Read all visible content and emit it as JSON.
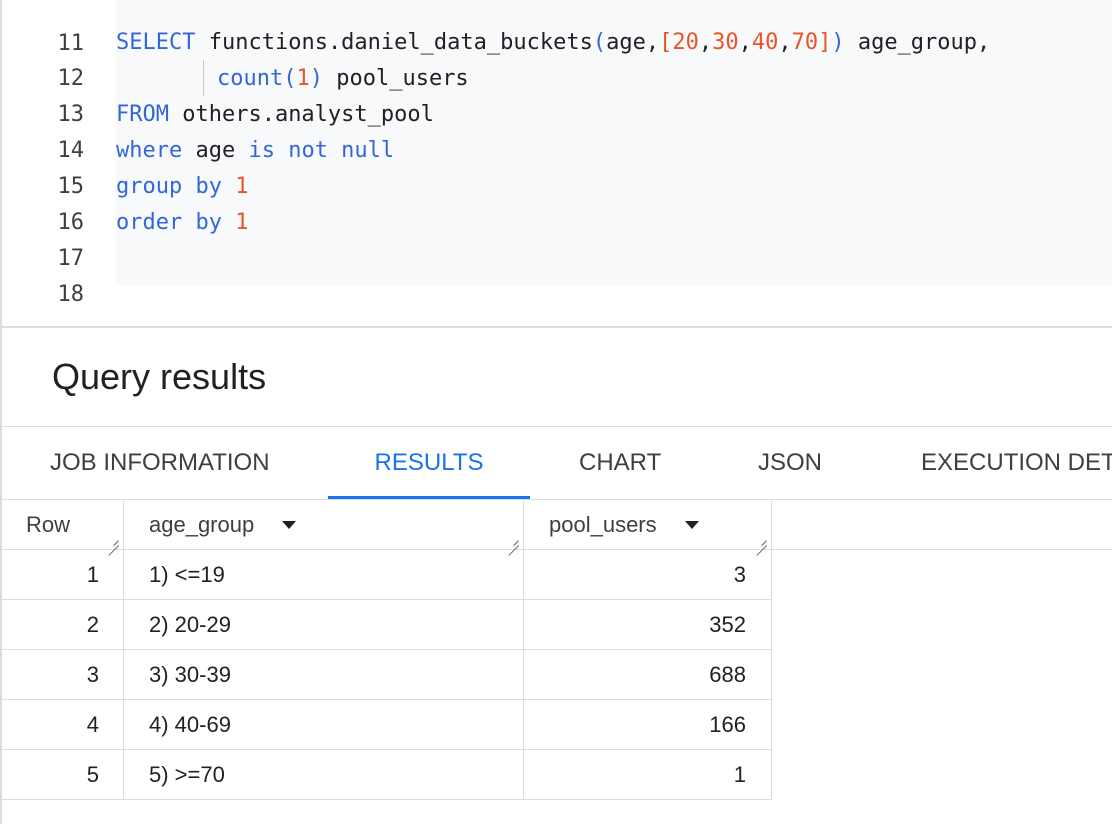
{
  "editor": {
    "lines": [
      {
        "num": "11"
      },
      {
        "num": "12"
      },
      {
        "num": "13"
      },
      {
        "num": "14"
      },
      {
        "num": "15"
      },
      {
        "num": "16"
      },
      {
        "num": "17"
      },
      {
        "num": "18"
      }
    ],
    "tokens": {
      "select": "SELECT",
      "fn_name": "functions.daniel_data_buckets",
      "paren_open": "(",
      "age": "age,",
      "bracket_open": "[",
      "n20": "20",
      "comma1": ",",
      "n30": "30",
      "comma2": ",",
      "n40": "40",
      "comma3": ",",
      "n70": "70",
      "bracket_close": "]",
      "paren_close": ")",
      "alias_age_group": " age_group,",
      "count": "count(",
      "one": "1",
      "count_close": ")",
      "alias_pool_users": " pool_users",
      "from": "FROM",
      "table": " others.analyst_pool",
      "where": "where",
      "where_col": " age ",
      "is_not_null": "is not null",
      "group_by": "group by",
      "group_val": " 1",
      "order_by": "order by",
      "order_val": " 1"
    }
  },
  "results": {
    "title": "Query results",
    "tabs": [
      {
        "label": "JOB INFORMATION"
      },
      {
        "label": "RESULTS"
      },
      {
        "label": "CHART"
      },
      {
        "label": "JSON"
      },
      {
        "label": "EXECUTION DETAILS"
      }
    ],
    "active_tab": "RESULTS",
    "columns": {
      "row": "Row",
      "age_group": "age_group",
      "pool_users": "pool_users"
    },
    "rows": [
      {
        "row": "1",
        "age_group": "1) <=19",
        "pool_users": "3"
      },
      {
        "row": "2",
        "age_group": "2) 20-29",
        "pool_users": "352"
      },
      {
        "row": "3",
        "age_group": "3) 30-39",
        "pool_users": "688"
      },
      {
        "row": "4",
        "age_group": "4) 40-69",
        "pool_users": "166"
      },
      {
        "row": "5",
        "age_group": "5) >=70",
        "pool_users": "1"
      }
    ]
  },
  "colors": {
    "keyword": "#3367d6",
    "number": "#e8542a",
    "accent": "#1a73e8",
    "text": "#202124"
  },
  "icons": {
    "sort": "arrow-drop-down-icon",
    "resize": "column-resize-icon"
  }
}
